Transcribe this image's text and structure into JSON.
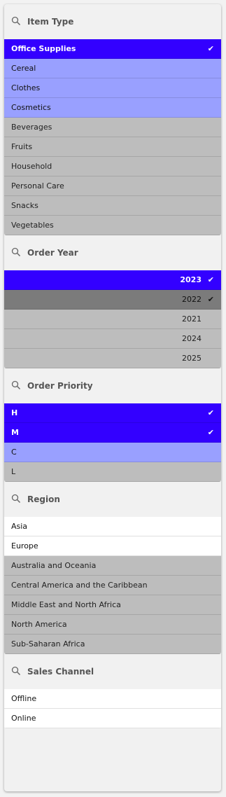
{
  "filters": [
    {
      "title": "Item Type",
      "icon": "search-icon",
      "align": "left",
      "items": [
        {
          "label": "Office Supplies",
          "state": "selected",
          "checked": true
        },
        {
          "label": "Cereal",
          "state": "possible",
          "checked": false
        },
        {
          "label": "Clothes",
          "state": "possible",
          "checked": false
        },
        {
          "label": "Cosmetics",
          "state": "possible",
          "checked": false
        },
        {
          "label": "Beverages",
          "state": "excluded",
          "checked": false
        },
        {
          "label": "Fruits",
          "state": "excluded",
          "checked": false
        },
        {
          "label": "Household",
          "state": "excluded",
          "checked": false
        },
        {
          "label": "Personal Care",
          "state": "excluded",
          "checked": false
        },
        {
          "label": "Snacks",
          "state": "excluded",
          "checked": false
        },
        {
          "label": "Vegetables",
          "state": "excluded",
          "checked": false
        }
      ]
    },
    {
      "title": "Order Year",
      "icon": "search-icon",
      "align": "right",
      "items": [
        {
          "label": "2023",
          "state": "selected",
          "checked": true
        },
        {
          "label": "2022",
          "state": "alt-selected",
          "checked": true
        },
        {
          "label": "2021",
          "state": "excluded",
          "checked": false
        },
        {
          "label": "2024",
          "state": "excluded",
          "checked": false
        },
        {
          "label": "2025",
          "state": "excluded",
          "checked": false
        }
      ]
    },
    {
      "title": "Order Priority",
      "icon": "search-icon",
      "align": "left",
      "items": [
        {
          "label": "H",
          "state": "selected",
          "checked": true
        },
        {
          "label": "M",
          "state": "selected",
          "checked": true
        },
        {
          "label": "C",
          "state": "possible",
          "checked": false
        },
        {
          "label": "L",
          "state": "excluded",
          "checked": false
        }
      ]
    },
    {
      "title": "Region",
      "icon": "search-icon",
      "align": "left",
      "items": [
        {
          "label": "Asia",
          "state": "white",
          "checked": false
        },
        {
          "label": "Europe",
          "state": "white",
          "checked": false
        },
        {
          "label": "Australia and Oceania",
          "state": "excluded",
          "checked": false
        },
        {
          "label": "Central America and the Caribbean",
          "state": "excluded",
          "checked": false
        },
        {
          "label": "Middle East and North Africa",
          "state": "excluded",
          "checked": false
        },
        {
          "label": "North America",
          "state": "excluded",
          "checked": false
        },
        {
          "label": "Sub-Saharan Africa",
          "state": "excluded",
          "checked": false
        }
      ]
    },
    {
      "title": "Sales Channel",
      "icon": "search-icon",
      "align": "left",
      "items": [
        {
          "label": "Offline",
          "state": "white",
          "checked": false
        },
        {
          "label": "Online",
          "state": "white",
          "checked": false
        }
      ]
    }
  ],
  "check_glyph": "✔",
  "colors": {
    "selected": "#3300ff",
    "possible": "#99a0ff",
    "excluded": "#bdbdbd",
    "alt_selected": "#7b7b7b",
    "white": "#ffffff"
  }
}
